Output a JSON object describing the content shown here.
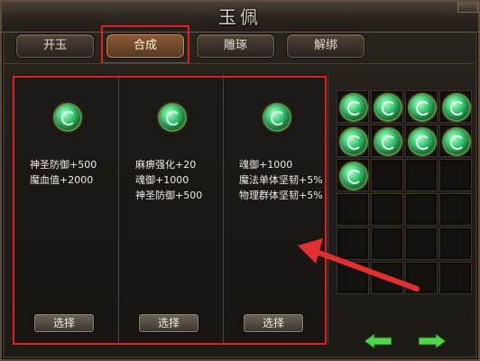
{
  "window": {
    "title": "玉佩"
  },
  "tabs": [
    {
      "label": "开玉",
      "active": false
    },
    {
      "label": "合成",
      "active": true
    },
    {
      "label": "雕琢",
      "active": false
    },
    {
      "label": "解绑",
      "active": false
    }
  ],
  "panels": [
    {
      "icon": "jade-pendant-icon",
      "stats": [
        "神圣防御+500",
        "魔血值+2000"
      ],
      "button": "选择"
    },
    {
      "icon": "jade-pendant-icon",
      "stats": [
        "麻痹强化+20",
        "魂御+1000",
        "神圣防御+500"
      ],
      "button": "选择"
    },
    {
      "icon": "jade-pendant-icon",
      "stats": [
        "魂御+1000",
        "魔法单体坚韧+5%",
        "物理群体坚韧+5%"
      ],
      "button": "选择"
    }
  ],
  "inventory": {
    "filled_slots": 9,
    "total_slots": 24,
    "item_icon": "jade-pendant-icon"
  },
  "navigation": {
    "prev_icon": "green-left-arrow-icon",
    "next_icon": "green-right-arrow-icon"
  },
  "annotation": {
    "color": "#e02020"
  }
}
